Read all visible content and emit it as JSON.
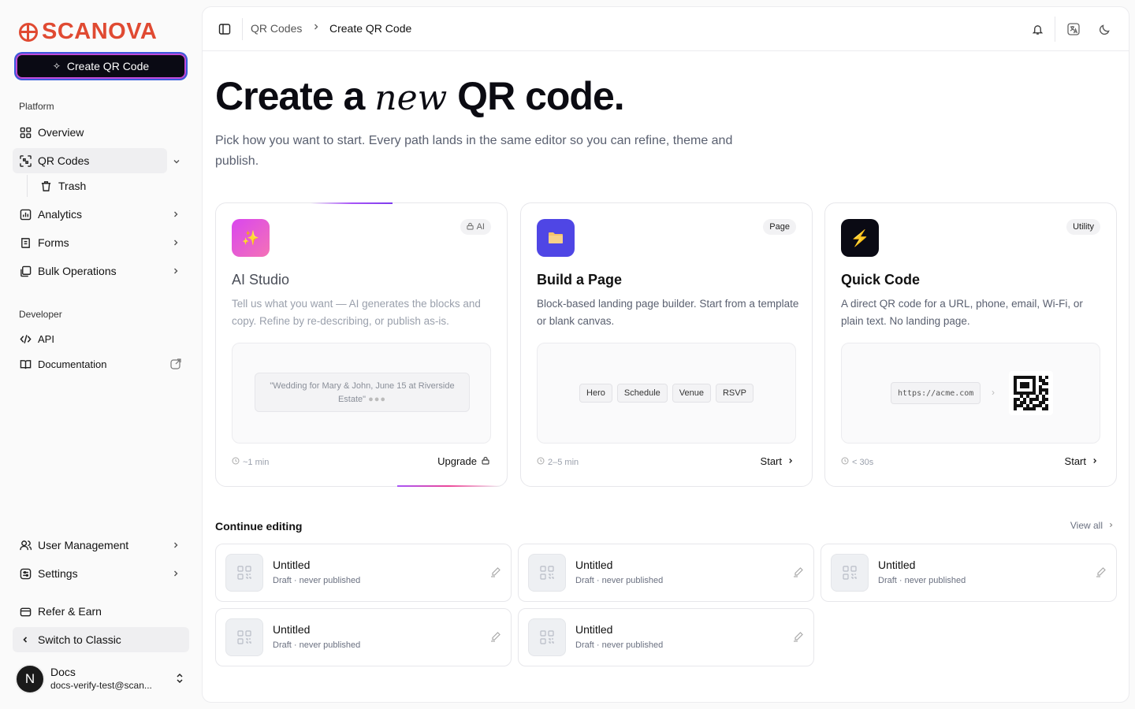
{
  "brand": {
    "name": "SCANOVA",
    "color": "#e04a32"
  },
  "sidebar": {
    "create_label": "Create QR Code",
    "platform_label": "Platform",
    "developer_label": "Developer",
    "items": {
      "overview": "Overview",
      "qr_codes": "QR Codes",
      "trash": "Trash",
      "analytics": "Analytics",
      "forms": "Forms",
      "bulk": "Bulk Operations",
      "api": "API",
      "documentation": "Documentation",
      "user_management": "User Management",
      "settings": "Settings",
      "refer": "Refer & Earn",
      "switch_classic": "Switch to Classic"
    },
    "user": {
      "initial": "N",
      "name": "Docs",
      "email": "docs-verify-test@scan..."
    }
  },
  "topbar": {
    "crumb_parent": "QR Codes",
    "crumb_sep": ">",
    "crumb_current": "Create QR Code"
  },
  "hero": {
    "title_pre": "Create a ",
    "title_em": "new",
    "title_post": " QR code.",
    "subtitle": "Pick how you want to start. Every path lands in the same editor so you can refine, theme and publish."
  },
  "cards": [
    {
      "badge": "AI",
      "title": "AI Studio",
      "desc": "Tell us what you want — AI generates the blocks and copy. Refine by re-describing, or publish as-is.",
      "prompt": "\"Wedding for Mary & John, June 15 at Riverside Estate\"",
      "time": "~1 min",
      "action": "Upgrade",
      "icon": "sparkles-icon",
      "accent": "#d946ef"
    },
    {
      "badge": "Page",
      "title": "Build a Page",
      "desc": "Block-based landing page builder. Start from a template or blank canvas.",
      "chips": [
        "Hero",
        "Schedule",
        "Venue",
        "RSVP"
      ],
      "time": "2–5 min",
      "action": "Start",
      "icon": "folder-icon",
      "accent": "#4f46e5"
    },
    {
      "badge": "Utility",
      "title": "Quick Code",
      "desc": "A direct QR code for a URL, phone, email, Wi-Fi, or plain text. No landing page.",
      "url": "https://acme.com",
      "time": "< 30s",
      "action": "Start",
      "icon": "lightning-icon",
      "accent": "#0a0a14"
    }
  ],
  "continue": {
    "title": "Continue editing",
    "view_all": "View all",
    "drafts": [
      {
        "title": "Untitled",
        "sub": "Draft · never published"
      },
      {
        "title": "Untitled",
        "sub": "Draft · never published"
      },
      {
        "title": "Untitled",
        "sub": "Draft · never published"
      },
      {
        "title": "Untitled",
        "sub": "Draft · never published"
      },
      {
        "title": "Untitled",
        "sub": "Draft · never published"
      }
    ]
  }
}
